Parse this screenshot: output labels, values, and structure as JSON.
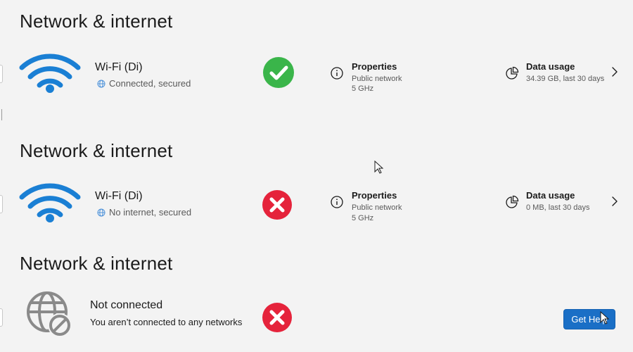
{
  "sections": [
    {
      "heading": "Network & internet",
      "network_name": "Wi-Fi (Di)",
      "status_text": "Connected, secured",
      "status": "ok",
      "properties": {
        "title": "Properties",
        "network_type": "Public network",
        "band": "5 GHz"
      },
      "data_usage": {
        "title": "Data usage",
        "value": "34.39 GB, last 30 days"
      }
    },
    {
      "heading": "Network & internet",
      "network_name": "Wi-Fi (Di)",
      "status_text": "No internet, secured",
      "status": "error",
      "properties": {
        "title": "Properties",
        "network_type": "Public network",
        "band": "5 GHz"
      },
      "data_usage": {
        "title": "Data usage",
        "value": "0 MB, last 30 days"
      }
    },
    {
      "heading": "Network & internet",
      "title": "Not connected",
      "subtitle": "You aren’t connected to any networks",
      "status": "error",
      "help_button": "Get Help"
    }
  ],
  "colors": {
    "wifi_blue": "#1a7fd4",
    "success_green": "#3ab54a",
    "error_red": "#e5233b",
    "button_blue": "#1a6fc6"
  },
  "icons": {
    "wifi": "wifi-icon",
    "globe": "globe-icon",
    "check": "check-circle-icon",
    "error": "x-circle-icon",
    "info": "info-icon",
    "pie": "pie-chart-icon",
    "chevron": "chevron-right-icon",
    "globe_blocked": "globe-blocked-icon",
    "cursor": "mouse-cursor-icon"
  }
}
